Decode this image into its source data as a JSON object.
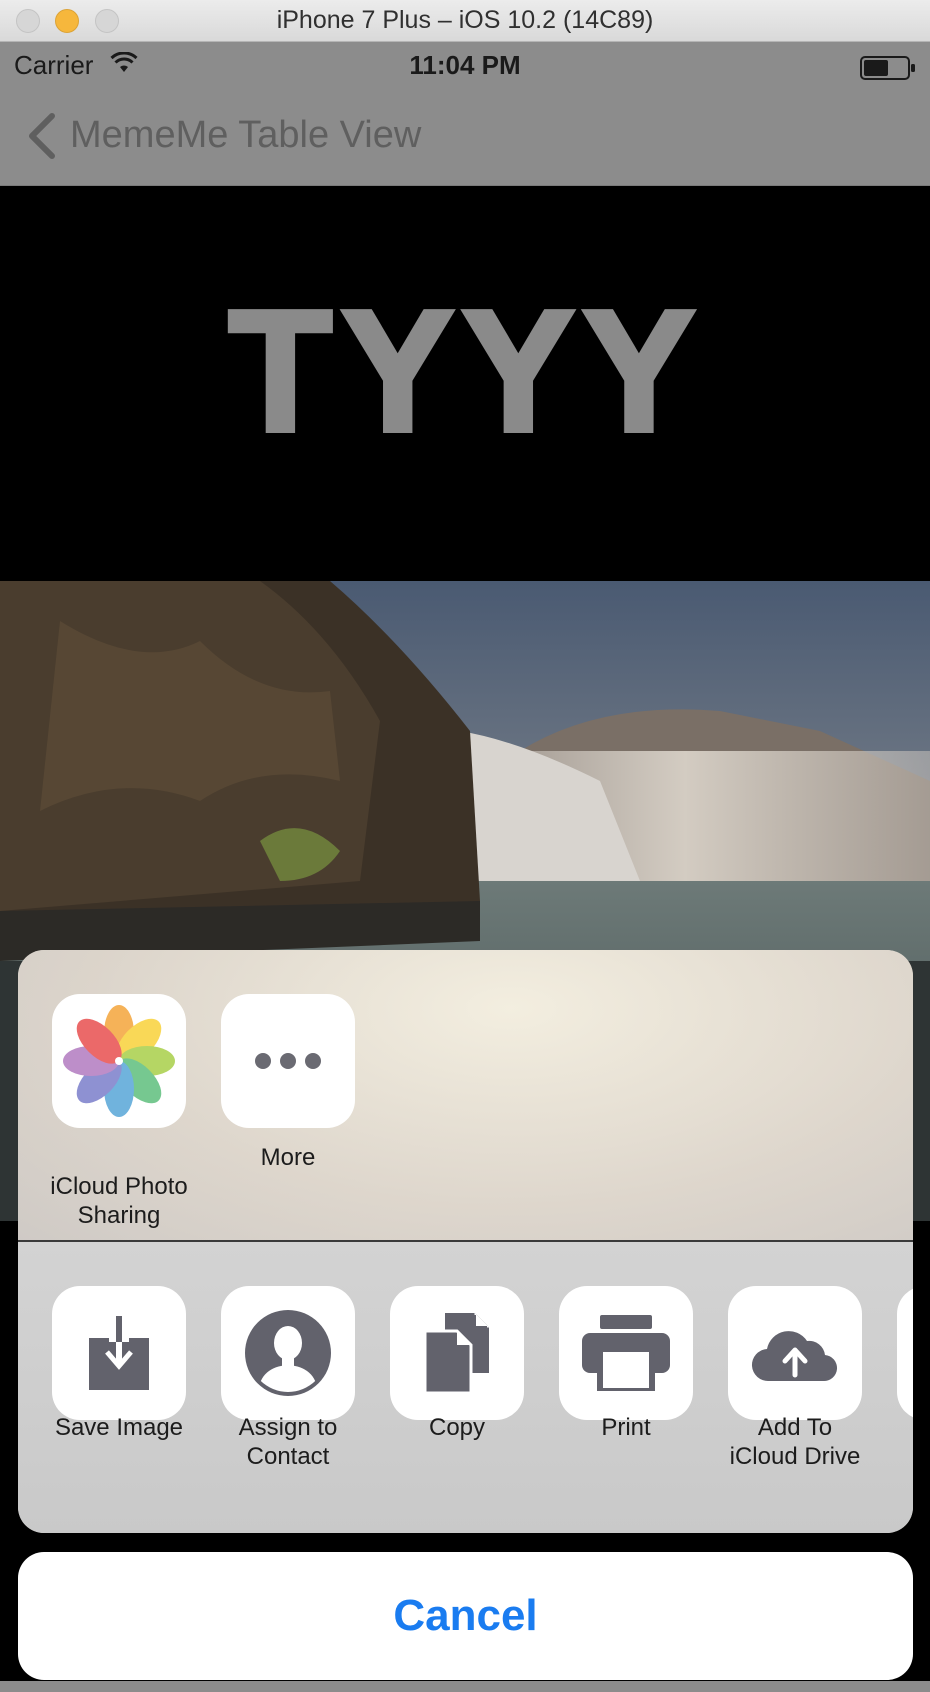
{
  "window": {
    "title": "iPhone 7 Plus – iOS 10.2 (14C89)"
  },
  "status_bar": {
    "carrier": "Carrier",
    "time": "11:04 PM"
  },
  "nav": {
    "back_label": "MemeMe Table View"
  },
  "meme": {
    "top_text": "TYYY"
  },
  "share_sheet": {
    "share_items": [
      {
        "label": "iCloud Photo\nSharing",
        "icon": "photos-icon"
      },
      {
        "label": "More",
        "icon": "more-icon"
      }
    ],
    "action_items": [
      {
        "label": "Save Image",
        "icon": "save-image-icon"
      },
      {
        "label": "Assign to\nContact",
        "icon": "contact-icon"
      },
      {
        "label": "Copy",
        "icon": "copy-icon"
      },
      {
        "label": "Print",
        "icon": "print-icon"
      },
      {
        "label": "Add To\niCloud Drive",
        "icon": "icloud-upload-icon"
      }
    ],
    "cancel_label": "Cancel"
  },
  "colors": {
    "accent": "#1a7cf0",
    "action_icon": "#62626c"
  }
}
